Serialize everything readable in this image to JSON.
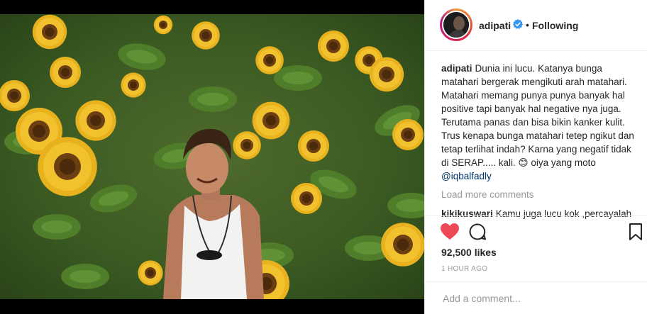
{
  "header": {
    "username": "adipati",
    "separator": "•",
    "follow_status": "Following"
  },
  "caption": {
    "username": "adipati",
    "text": "Dunia ini lucu. Katanya bunga matahari bergerak mengikuti arah matahari. Matahari memang punya punya banyak hal positive tapi banyak hal negative nya juga. Terutama panas dan bisa bikin kanker kulit. Trus kenapa bunga matahari tetep ngikut dan tetap terlihat indah? Karna yang negatif tidak di SERAP..... kali. 😊 oiya yang moto ",
    "mention": "@iqbalfadly"
  },
  "load_more": "Load more comments",
  "comment": {
    "username": "kikikuswari",
    "text": "Kamu juga lucu kok ,percayalah"
  },
  "likes": "92,500 likes",
  "time": "1 HOUR AGO",
  "add_comment": {
    "placeholder": "Add a comment..."
  },
  "icons": {
    "like": "heart-icon-filled",
    "comment": "comment-bubble-icon",
    "save": "bookmark-icon",
    "verified": "verified-badge-icon"
  },
  "colors": {
    "like_red": "#ed4956",
    "verified_blue": "#3897f0",
    "mention_blue": "#003569",
    "muted_gray": "#999999"
  }
}
